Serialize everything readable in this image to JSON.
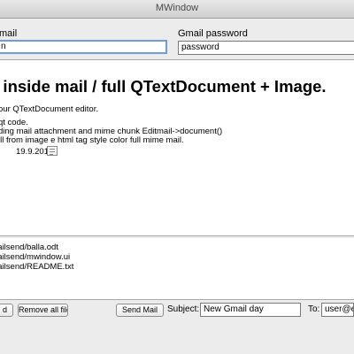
{
  "window": {
    "title": "MWindow"
  },
  "login": {
    "email_label": "mail",
    "email_value": "n",
    "password_label": "Gmail password",
    "password_value": "password"
  },
  "editor": {
    "heading": "e inside mail / full QTextDocument + Image.",
    "lines": [
      "our QTextDocument editor.",
      "qt code.",
      "ding mail attachment and mime chunk Editmail->document()",
      "ill from image e html tag  style color full mime mail.",
      "19.9.2013"
    ]
  },
  "attachments": {
    "files": [
      "nailsend/balla.odt",
      "nailsend/mwindow.ui",
      "nailsend/README.txt"
    ]
  },
  "toolbar": {
    "add_label": "d",
    "remove_all_label": "Remove all file",
    "send_label": "Send Mail",
    "subject_label": "Subject:",
    "subject_value": "New Gmail day",
    "to_label": "To:",
    "to_value": "user@ex"
  }
}
